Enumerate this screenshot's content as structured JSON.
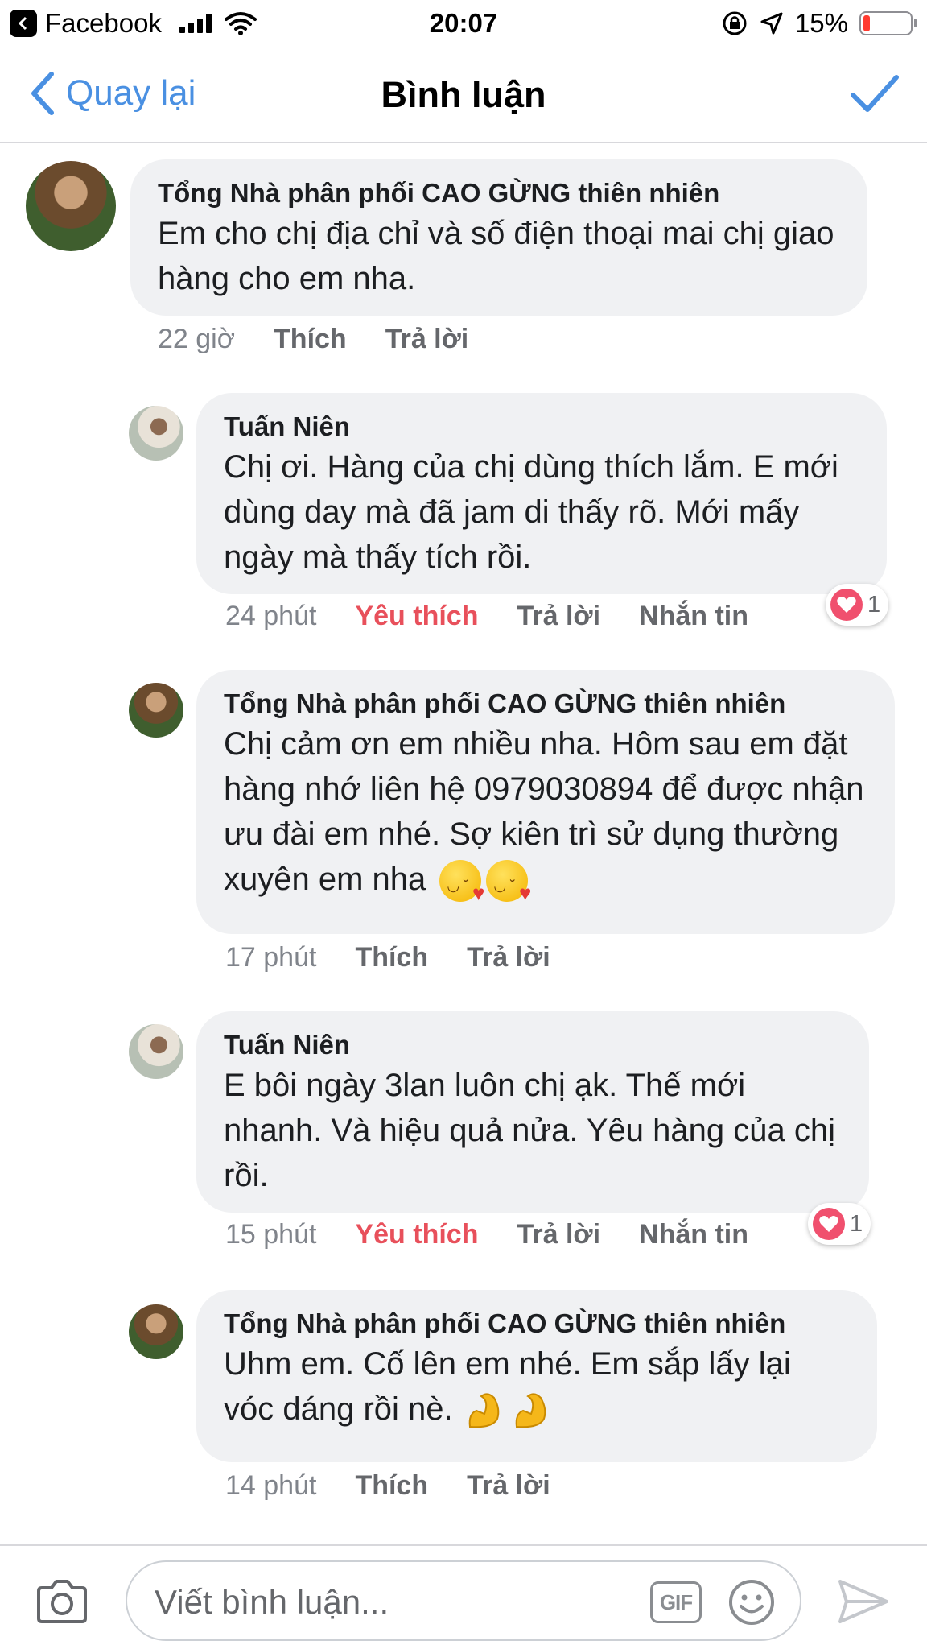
{
  "status_bar": {
    "app": "Facebook",
    "time": "20:07",
    "battery": "15%",
    "battery_level": 0.15
  },
  "nav": {
    "back_label": "Quay lại",
    "title": "Bình luận"
  },
  "comments": [
    {
      "author": "Tổng Nhà phân phối CAO GỪNG thiên nhiên",
      "text": "Em cho chị địa chỉ và số điện thoại mai chị giao hàng cho em nha.",
      "time": "22 giờ",
      "like": "Thích",
      "reply": "Trả lời"
    },
    {
      "author": "Tuấn Niên",
      "text": "Chị ơi. Hàng của chị dùng thích lắm. E mới dùng day mà đã jam di thấy rõ. Mới mấy ngày mà thấy tích rồi.",
      "time": "24 phút",
      "like": "Yêu thích",
      "reply": "Trả lời",
      "message": "Nhắn tin",
      "reaction_count": "1"
    },
    {
      "author": "Tổng Nhà phân phối CAO GỪNG thiên nhiên",
      "text": "Chị cảm ơn em nhiều nha. Hôm sau em đặt hàng nhớ liên hệ 0979030894 để được nhận ưu đài em nhé. Sợ kiên trì sử dụng thường xuyên em nha",
      "time": "17 phút",
      "like": "Thích",
      "reply": "Trả lời"
    },
    {
      "author": "Tuấn Niên",
      "text": "E bôi ngày 3lan luôn chị ạk. Thế mới nhanh. Và hiệu quả nửa. Yêu hàng của chị rồi.",
      "time": "15 phút",
      "like": "Yêu thích",
      "reply": "Trả lời",
      "message": "Nhắn tin",
      "reaction_count": "1"
    },
    {
      "author": "Tổng Nhà phân phối CAO GỪNG thiên nhiên",
      "text": "Uhm em. Cố lên em nhé. Em sắp lấy lại vóc dáng rồi nè.",
      "time": "14 phút",
      "like": "Thích",
      "reply": "Trả lời"
    }
  ],
  "composer": {
    "placeholder": "Viết bình luận...",
    "gif_label": "GIF"
  },
  "colors": {
    "accent": "#4a90e2",
    "love": "#e8505b",
    "bubble": "#f0f1f3"
  },
  "icons": [
    "back-app-icon",
    "signal-icon",
    "wifi-icon",
    "lock-rotation-icon",
    "location-icon",
    "battery-icon",
    "chevron-left-icon",
    "checkmark-icon",
    "heart-icon",
    "kiss-emoji",
    "muscle-emoji",
    "camera-icon",
    "gif-icon",
    "smile-icon",
    "send-icon"
  ]
}
